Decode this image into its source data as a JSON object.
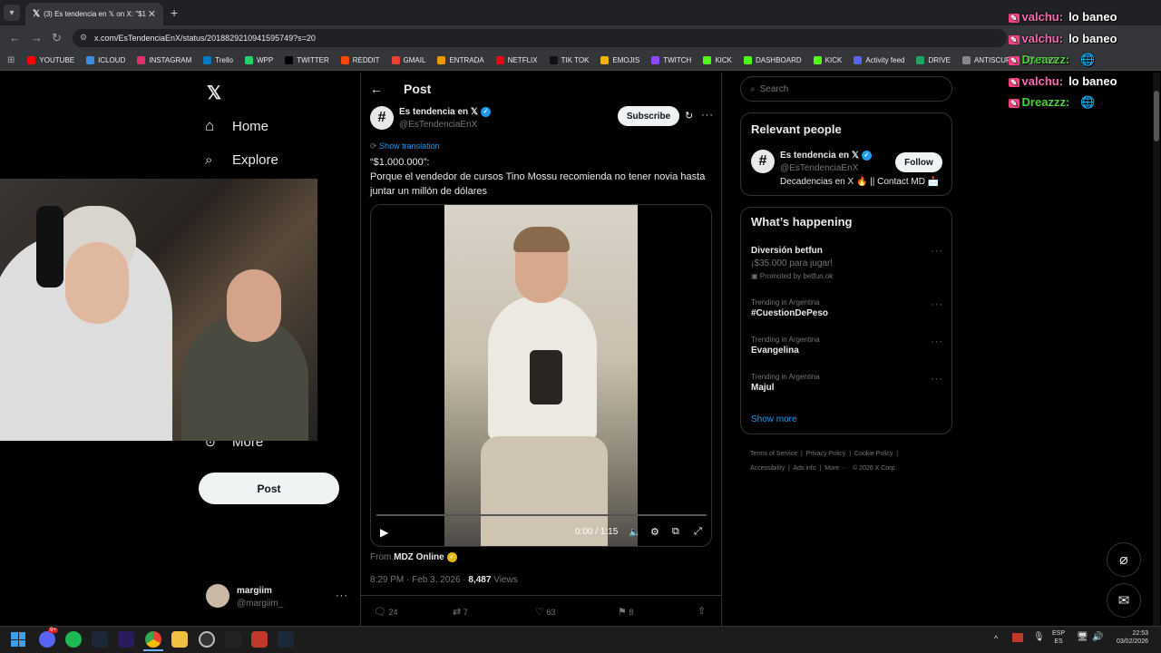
{
  "browser": {
    "tab_title": "(3) Es tendencia en 𝕏 on X: \"$1",
    "url": "x.com/EsTendenciaEnX/status/2018829210941595749?s=20",
    "bookmarks": [
      "YOUTUBE",
      "ICLOUD",
      "INSTAGRAM",
      "Trello",
      "WPP",
      "TWITTER",
      "REDDIT",
      "GMAIL",
      "ENTRADA",
      "NETFLIX",
      "TIK TOK",
      "EMOJIS",
      "TWITCH",
      "KICK",
      "DASHBOARD",
      "KICK",
      "Activity feed",
      "DRIVE",
      "ANTISCUFF",
      "FUEN"
    ],
    "bookmark_colors": [
      "#ff0000",
      "#3a8ee6",
      "#e1306c",
      "#0079bf",
      "#25d366",
      "#000000",
      "#ff4500",
      "#ea4335",
      "#f29900",
      "#e50914",
      "#111111",
      "#f4b400",
      "#9146ff",
      "#53fc18",
      "#53fc18",
      "#53fc18",
      "#5865f2",
      "#1fa463",
      "#888888",
      "#888888"
    ]
  },
  "nav": {
    "home": "Home",
    "explore": "Explore",
    "more": "More",
    "post_button": "Post",
    "account_name": "margiim",
    "account_handle": "@margiim_"
  },
  "post": {
    "header": "Post",
    "author_name": "Es tendencia en 𝕏",
    "author_handle": "@EsTendenciaEnX",
    "subscribe": "Subscribe",
    "show_translation": "Show translation",
    "text_line1": "“$1.000.000”:",
    "text_line2": "Porque el vendedor de cursos Tino Mossu recomienda no tener novia hasta juntar un millón de dólares",
    "video_time": "0:00 / 1:15",
    "from_label": "From",
    "from_source": "MDZ Online",
    "timestamp": "8:29 PM · Feb 3, 2026 · ",
    "views_count": "8,487",
    "views_label": " Views",
    "replies": "24",
    "reposts": "7",
    "likes": "63",
    "bookmarks": "8"
  },
  "sidebar": {
    "search_placeholder": "Search",
    "relevant_title": "Relevant people",
    "rp_name": "Es tendencia en 𝕏",
    "rp_handle": "@EsTendenciaEnX",
    "rp_bio": "Decadencias en X 🔥 || Contact MD 📩",
    "follow": "Follow",
    "happening_title": "What’s happening",
    "promo_title": "Diversión betfun",
    "promo_sub": "¡$35.000 para jugar!",
    "promo_by": "Promoted by betfun.ok",
    "trends": [
      {
        "context": "Trending in Argentina",
        "name": "#CuestionDePeso"
      },
      {
        "context": "Trending in Argentina",
        "name": "Evangelina"
      },
      {
        "context": "Trending in Argentina",
        "name": "Majul"
      }
    ],
    "show_more": "Show more",
    "footer": [
      "Terms of Service",
      "Privacy Policy",
      "Cookie Policy",
      "Accessibility",
      "Ads info",
      "More ···",
      "© 2026 X Corp."
    ]
  },
  "chat": [
    {
      "user": "valchu:",
      "msg": "lo baneo",
      "color": "#ff69b4"
    },
    {
      "user": "valchu:",
      "msg": "lo baneo",
      "color": "#ff69b4"
    },
    {
      "user": "Dreazzz:",
      "msg": "",
      "color": "#4cd137"
    },
    {
      "user": "valchu:",
      "msg": "lo baneo",
      "color": "#ff69b4"
    },
    {
      "user": "Dreazzz:",
      "msg": "",
      "color": "#4cd137"
    }
  ],
  "taskbar": {
    "lang": "ESP",
    "lang2": "ES",
    "time": "22:53",
    "date": "03/02/2026",
    "discord_badge": "9+"
  }
}
